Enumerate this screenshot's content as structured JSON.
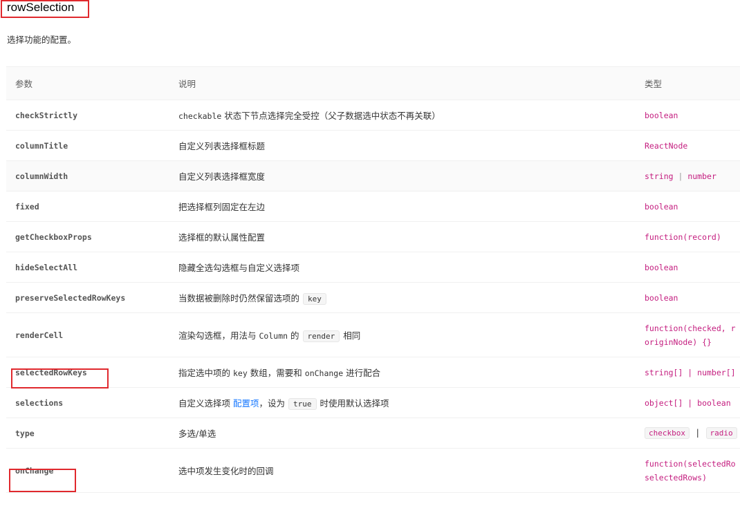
{
  "section": {
    "title": "rowSelection",
    "description": "选择功能的配置。"
  },
  "table": {
    "headers": {
      "param": "参数",
      "desc": "说明",
      "type": "类型"
    },
    "rows": [
      {
        "param": "checkStrictly",
        "desc_code": "checkable",
        "desc_text": " 状态下节点选择完全受控（父子数据选中状态不再关联）",
        "type": "boolean"
      },
      {
        "param": "columnTitle",
        "desc": "自定义列表选择框标题",
        "type": "ReactNode"
      },
      {
        "param": "columnWidth",
        "desc": "自定义列表选择框宽度",
        "type_a": "string",
        "type_sep": " | ",
        "type_b": "number"
      },
      {
        "param": "fixed",
        "desc": "把选择框列固定在左边",
        "type": "boolean"
      },
      {
        "param": "getCheckboxProps",
        "desc": "选择框的默认属性配置",
        "type": "function(record)"
      },
      {
        "param": "hideSelectAll",
        "desc": "隐藏全选勾选框与自定义选择项",
        "type": "boolean"
      },
      {
        "param": "preserveSelectedRowKeys",
        "desc": "当数据被删除时仍然保留选项的",
        "desc_chip": "key",
        "type": "boolean"
      },
      {
        "param": "renderCell",
        "desc_1": "渲染勾选框，用法与",
        "desc_code": "Column",
        "desc_2": "的",
        "desc_chip": "render",
        "desc_3": "相同",
        "type_line1": "function(checked, r",
        "type_line2": "originNode) {}"
      },
      {
        "param": "selectedRowKeys",
        "desc_1": "指定选中项的",
        "desc_code1": "key",
        "desc_2": "数组，需要和",
        "desc_code2": "onChange",
        "desc_3": "进行配合",
        "type": "string[] | number[]"
      },
      {
        "param": "selections",
        "desc_1": "自定义选择项",
        "desc_link": "配置项",
        "desc_2": "，设为",
        "desc_chip": "true",
        "desc_3": "时使用默认选择项",
        "type": "object[] | boolean"
      },
      {
        "param": "type",
        "desc": "多选/单选",
        "type_chip_a": "checkbox",
        "type_sep": "|",
        "type_chip_b": "radio"
      },
      {
        "param": "onChange",
        "desc": "选中项发生变化时的回调",
        "type_line1": "function(selectedRo",
        "type_line2": "selectedRows)"
      }
    ]
  },
  "colors": {
    "highlight": "#e0282d",
    "type_text": "#c41d7f",
    "link": "#1677ff"
  }
}
